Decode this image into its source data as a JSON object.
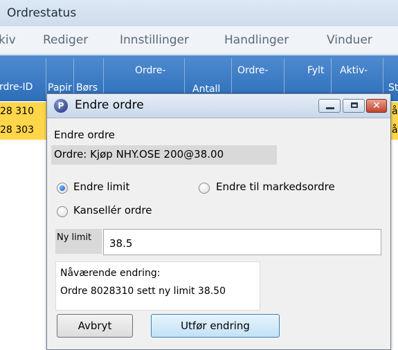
{
  "main_window": {
    "title": "Ordrestatus",
    "menu": [
      "kiv",
      "Rediger",
      "Innstillinger",
      "Handlinger",
      "Vinduer"
    ],
    "columns": [
      "rdre-ID",
      "Papir",
      "Børs",
      "Ordre-",
      "Antall",
      "Ordre-",
      "Fylt",
      "Aktiv-",
      "St"
    ],
    "rows": [
      {
        "id": "28 310",
        "tail": "å"
      },
      {
        "id": "28 303",
        "tail": "å"
      }
    ]
  },
  "dialog": {
    "title": "Endre ordre",
    "icon": "app-logo-icon",
    "subtitle": "Endre ordre",
    "order_summary": "Ordre: Kjøp NHY.OSE 200@38.00",
    "options": {
      "change_limit": "Endre limit",
      "to_market": "Endre til markedsordre",
      "cancel_order": "Kansellér ordre",
      "selected": "change_limit"
    },
    "limit_label": "Ny limit",
    "limit_value": "38.5",
    "status_line1": "Nåværende endring:",
    "status_line2": "Ordre 8028310 sett ny limit 38.50",
    "cancel_button": "Avbryt",
    "submit_button": "Utfør endring",
    "window_buttons": {
      "minimize": "minimize-icon",
      "maximize": "maximize-icon",
      "close": "close-icon"
    },
    "colors": {
      "row_highlight": "#ffd54a",
      "header": "#2e6fba"
    }
  }
}
